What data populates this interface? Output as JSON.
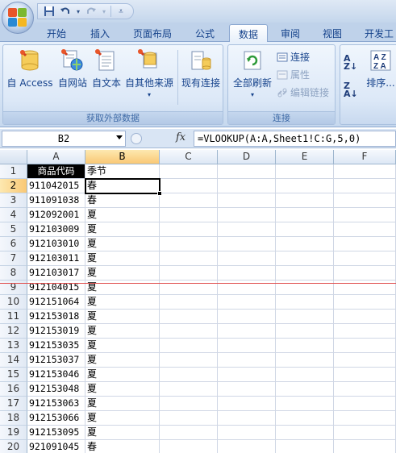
{
  "quick_access": {
    "save_icon": "save-icon",
    "undo_icon": "undo-icon",
    "redo_icon": "redo-icon"
  },
  "tabs": [
    {
      "label": "开始"
    },
    {
      "label": "插入"
    },
    {
      "label": "页面布局"
    },
    {
      "label": "公式"
    },
    {
      "label": "数据",
      "active": true
    },
    {
      "label": "审阅"
    },
    {
      "label": "视图"
    },
    {
      "label": "开发工"
    }
  ],
  "ribbon": {
    "external_data": {
      "group_label": "获取外部数据",
      "access": "自 Access",
      "web": "自网站",
      "text": "自文本",
      "other": "自其他来源",
      "existing": "现有连接"
    },
    "connections": {
      "group_label": "连接",
      "refresh_all": "全部刷新",
      "connections": "连接",
      "properties": "属性",
      "edit_links": "编辑链接"
    },
    "sort": {
      "sort": "排序..."
    }
  },
  "formula_bar": {
    "name_box": "B2",
    "fx": "fx",
    "formula": "=VLOOKUP(A:A,Sheet1!C:G,5,0)"
  },
  "sheet": {
    "columns": [
      "A",
      "B",
      "C",
      "D",
      "E",
      "F"
    ],
    "row_numbers": [
      "1",
      "2",
      "3",
      "4",
      "5",
      "6",
      "7",
      "8",
      "9",
      "10",
      "11",
      "12",
      "13",
      "14",
      "15",
      "16",
      "17",
      "18",
      "19",
      "20"
    ],
    "col_a": [
      "商品代码",
      "911042015",
      "911091038",
      "912092001",
      "912103009",
      "912103010",
      "912103011",
      "912103017",
      "912104015",
      "912151064",
      "912153018",
      "912153019",
      "912153035",
      "912153037",
      "912153046",
      "912153048",
      "912153063",
      "912153066",
      "912153095",
      "921091045"
    ],
    "col_b": [
      "季节",
      "春",
      "春",
      "夏",
      "夏",
      "夏",
      "夏",
      "夏",
      "夏",
      "夏",
      "夏",
      "夏",
      "夏",
      "夏",
      "夏",
      "夏",
      "夏",
      "夏",
      "夏",
      "春"
    ]
  },
  "colors": {
    "ribbon_bg": "#dce8f7",
    "selected_header": "#f9c875",
    "page_break": "#e05050"
  }
}
